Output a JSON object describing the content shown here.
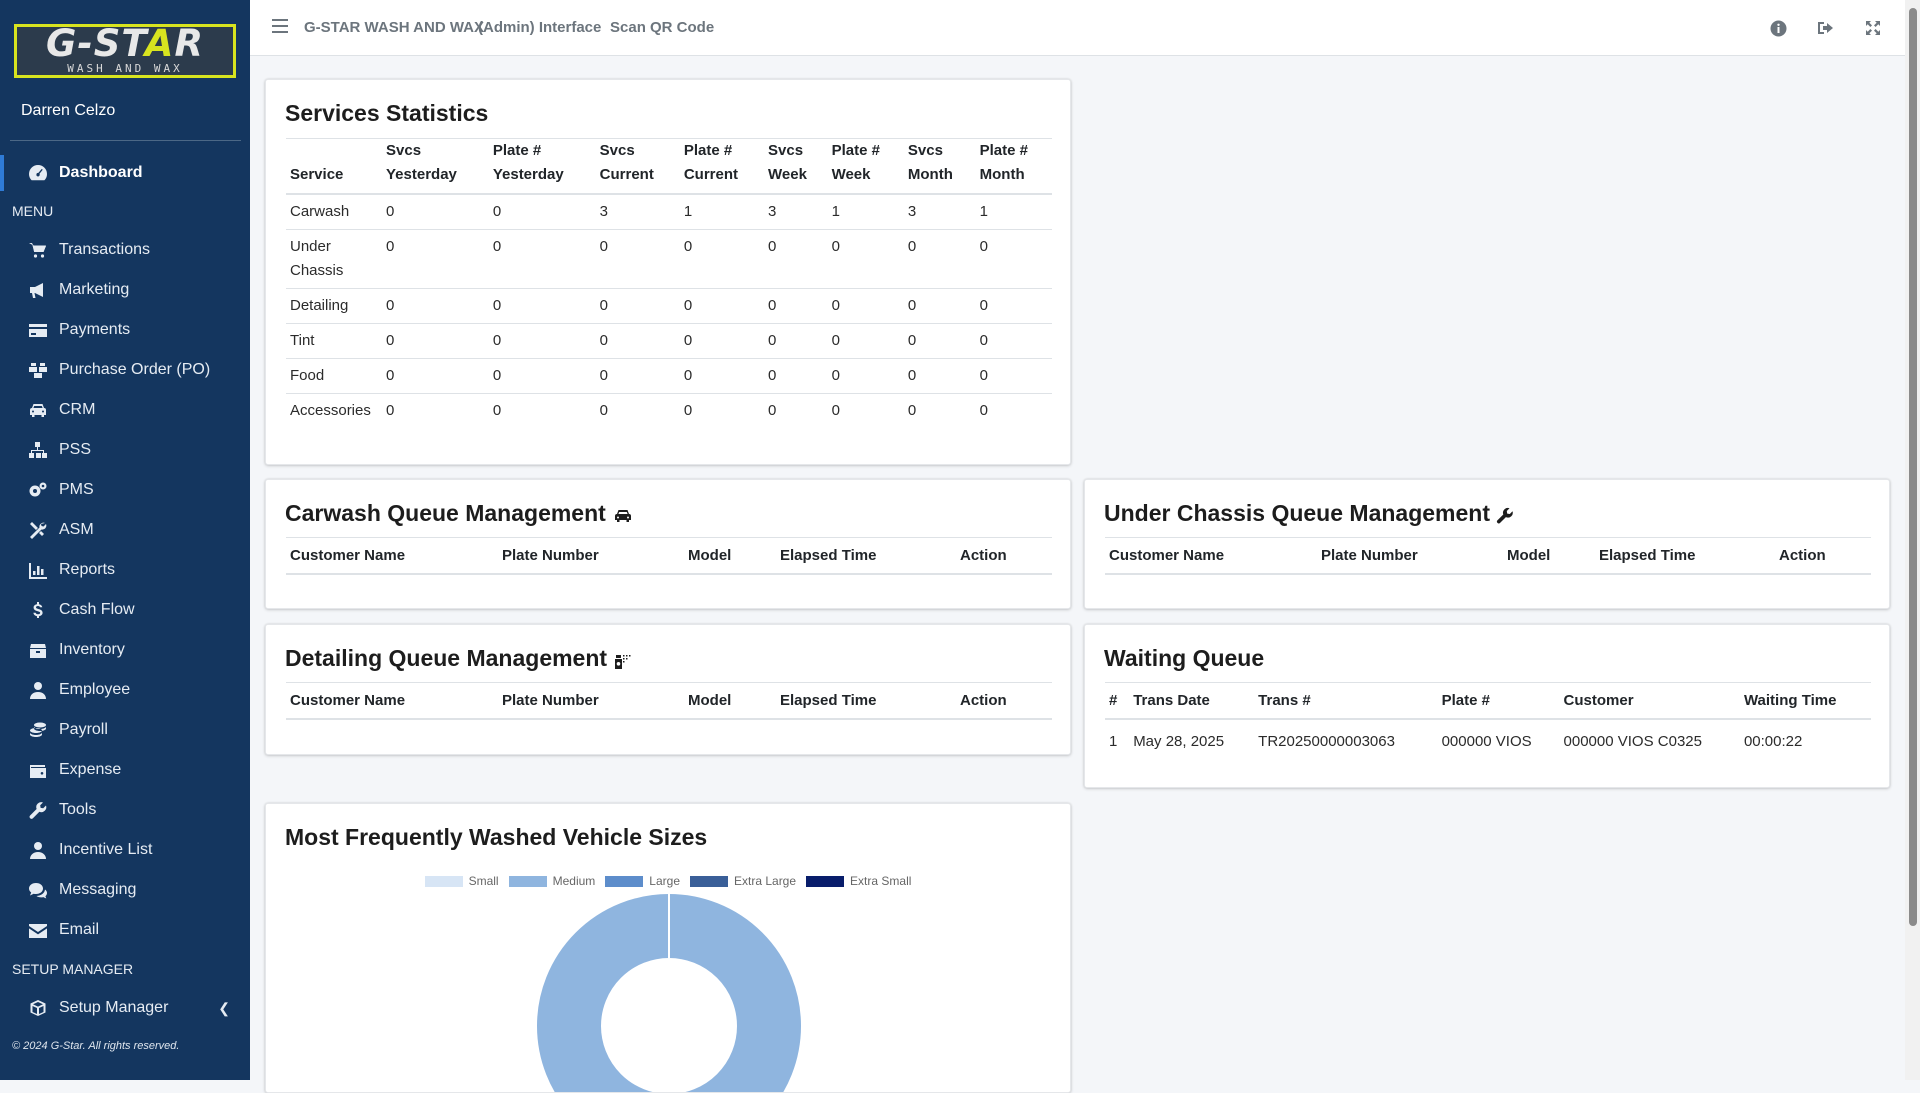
{
  "brand": {
    "logo_main_left": "G-ST",
    "logo_main_accent": "A",
    "logo_main_right": "R",
    "logo_sub": "WASH AND WAX"
  },
  "user": {
    "name": "Darren Celzo"
  },
  "nav": {
    "dashboard": "Dashboard",
    "menu_header": "MENU",
    "items": [
      {
        "label": "Transactions",
        "icon": "cart-icon"
      },
      {
        "label": "Marketing",
        "icon": "megaphone-icon"
      },
      {
        "label": "Payments",
        "icon": "credit-card-icon"
      },
      {
        "label": "Purchase Order (PO)",
        "icon": "boxes-icon"
      },
      {
        "label": "CRM",
        "icon": "car-icon"
      },
      {
        "label": "PSS",
        "icon": "sitemap-icon"
      },
      {
        "label": "PMS",
        "icon": "gears-icon"
      },
      {
        "label": "ASM",
        "icon": "tools-icon"
      },
      {
        "label": "Reports",
        "icon": "bar-chart-icon"
      },
      {
        "label": "Cash Flow",
        "icon": "dollar-icon"
      },
      {
        "label": "Inventory",
        "icon": "box-icon"
      },
      {
        "label": "Employee",
        "icon": "user-tie-icon"
      },
      {
        "label": "Payroll",
        "icon": "coins-icon"
      },
      {
        "label": "Expense",
        "icon": "wallet-icon"
      },
      {
        "label": "Tools",
        "icon": "wrench-icon"
      },
      {
        "label": "Incentive List",
        "icon": "user-icon"
      },
      {
        "label": "Messaging",
        "icon": "comments-icon"
      },
      {
        "label": "Email",
        "icon": "envelope-icon"
      }
    ],
    "setup_header": "SETUP MANAGER",
    "setup_item": "Setup Manager",
    "copyright": "© 2024 G-Star. All rights reserved."
  },
  "topbar": {
    "title": "G-STAR WASH AND WAX",
    "admin": "(Admin) Interface",
    "scan": "Scan QR Code"
  },
  "services": {
    "title": "Services Statistics",
    "headers": [
      [
        "",
        "Service"
      ],
      [
        "Svcs",
        "Yesterday"
      ],
      [
        "Plate #",
        "Yesterday"
      ],
      [
        "Svcs",
        "Current"
      ],
      [
        "Plate #",
        "Current"
      ],
      [
        "Svcs",
        "Week"
      ],
      [
        "Plate #",
        "Week"
      ],
      [
        "Svcs",
        "Month"
      ],
      [
        "Plate #",
        "Month"
      ]
    ],
    "rows": [
      [
        "Carwash",
        "0",
        "0",
        "3",
        "1",
        "3",
        "1",
        "3",
        "1"
      ],
      [
        "Under Chassis",
        "0",
        "0",
        "0",
        "0",
        "0",
        "0",
        "0",
        "0"
      ],
      [
        "Detailing",
        "0",
        "0",
        "0",
        "0",
        "0",
        "0",
        "0",
        "0"
      ],
      [
        "Tint",
        "0",
        "0",
        "0",
        "0",
        "0",
        "0",
        "0",
        "0"
      ],
      [
        "Food",
        "0",
        "0",
        "0",
        "0",
        "0",
        "0",
        "0",
        "0"
      ],
      [
        "Accessories",
        "0",
        "0",
        "0",
        "0",
        "0",
        "0",
        "0",
        "0"
      ]
    ]
  },
  "queue_headers": [
    "Customer Name",
    "Plate Number",
    "Model",
    "Elapsed Time",
    "Action"
  ],
  "carwash_queue": {
    "title": "Carwash Queue Management"
  },
  "under_chassis_queue": {
    "title": "Under Chassis Queue Management"
  },
  "detailing_queue": {
    "title": "Detailing Queue Management"
  },
  "waiting_queue": {
    "title": "Waiting Queue",
    "headers": [
      "#",
      "Trans Date",
      "Trans #",
      "Plate #",
      "Customer",
      "Waiting Time"
    ],
    "rows": [
      [
        "1",
        "May 28, 2025",
        "TR20250000003063",
        "000000 VIOS",
        "000000 VIOS C0325",
        "00:00:22"
      ]
    ]
  },
  "chart_data": {
    "type": "pie",
    "title": "Most Frequently Washed Vehicle Sizes",
    "variant": "doughnut",
    "categories": [
      "Small",
      "Medium",
      "Large",
      "Extra Large",
      "Extra Small"
    ],
    "values": [
      0,
      100,
      0,
      0,
      0
    ],
    "colors": [
      "#d7e5f5",
      "#8fb5df",
      "#5d8dcb",
      "#3a5f98",
      "#081d6b"
    ],
    "legend": "top"
  }
}
